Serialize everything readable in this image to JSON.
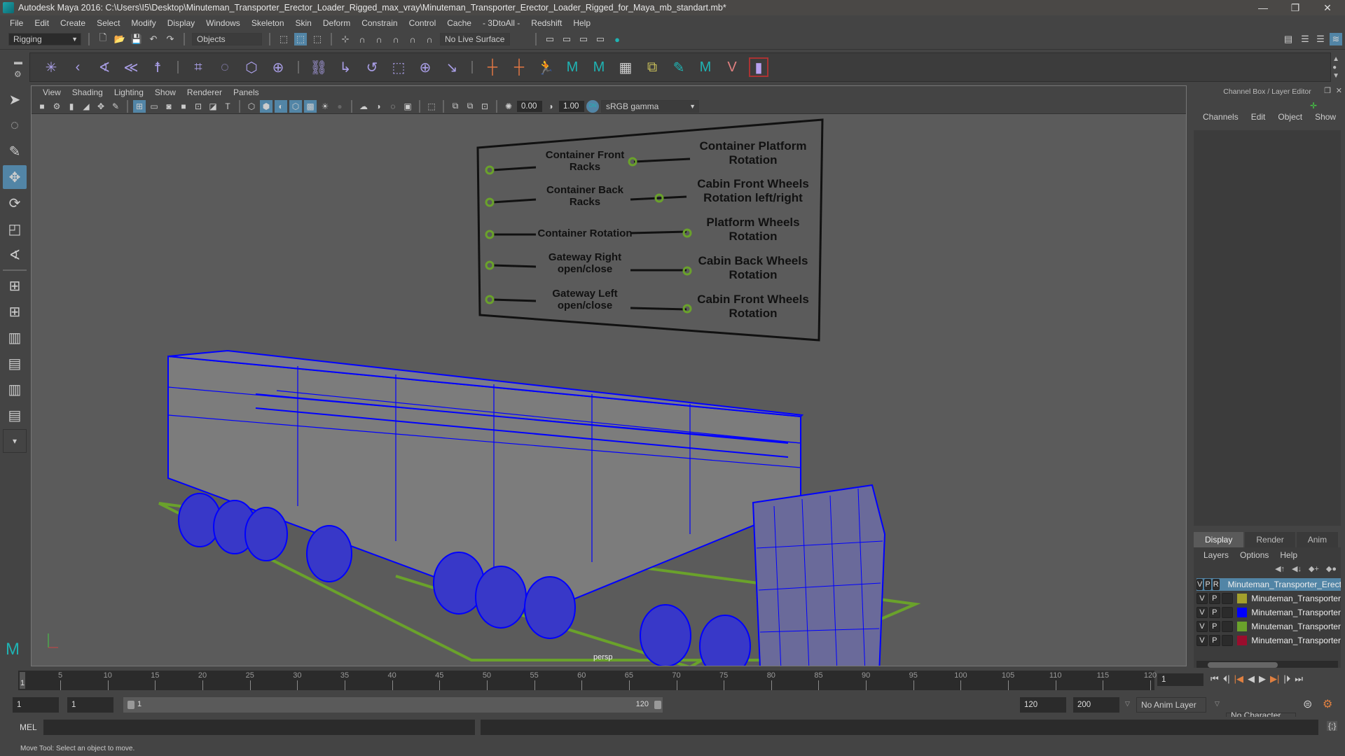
{
  "window": {
    "title": "Autodesk Maya 2016: C:\\Users\\I5\\Desktop\\Minuteman_Transporter_Erector_Loader_Rigged_max_vray\\Minuteman_Transporter_Erector_Loader_Rigged_for_Maya_mb_standart.mb*",
    "controls": [
      "minimize",
      "restore",
      "close"
    ]
  },
  "menubar": [
    "File",
    "Edit",
    "Create",
    "Select",
    "Modify",
    "Display",
    "Windows",
    "Skeleton",
    "Skin",
    "Deform",
    "Constrain",
    "Control",
    "Cache",
    "- 3DtoAll -",
    "Redshift",
    "Help"
  ],
  "statusline": {
    "menuset": "Rigging",
    "selection_mode": "Objects",
    "live_surface": "No Live Surface"
  },
  "viewport": {
    "panel_menu": [
      "View",
      "Shading",
      "Lighting",
      "Show",
      "Renderer",
      "Panels"
    ],
    "exposure": "0.00",
    "gamma": "1.00",
    "color_mgmt": "ON",
    "colorspace": "sRGB gamma",
    "camera": "persp",
    "control_board": {
      "left": [
        "Container Front Racks",
        "Container Back Racks",
        "Container Rotation",
        "Gateway Right open/close",
        "Gateway Left open/close"
      ],
      "right": [
        "Container Platform Rotation",
        "Cabin Front Wheels Rotation left/right",
        "Platform Wheels Rotation",
        "Cabin Back Wheels Rotation",
        "Cabin Front Wheels Rotation"
      ]
    },
    "colors": {
      "wireframe": "#0000ff",
      "ground": "#6aa22b",
      "background": "#5b5b5b"
    }
  },
  "channel_box": {
    "title": "Channel Box / Layer Editor",
    "menu": [
      "Channels",
      "Edit",
      "Object",
      "Show"
    ]
  },
  "layer_editor": {
    "tabs": [
      "Display",
      "Render",
      "Anim"
    ],
    "active_tab": "Display",
    "menu": [
      "Layers",
      "Options",
      "Help"
    ],
    "layers": [
      {
        "v": "V",
        "p": "P",
        "r": "R",
        "color": "#0e4d24",
        "name": "Minuteman_Transporter_Erector",
        "selected": true
      },
      {
        "v": "V",
        "p": "P",
        "r": "",
        "color": "#a3a02c",
        "name": "Minuteman_Transporter",
        "selected": false
      },
      {
        "v": "V",
        "p": "P",
        "r": "",
        "color": "#0000ff",
        "name": "Minuteman_Transporter",
        "selected": false
      },
      {
        "v": "V",
        "p": "P",
        "r": "",
        "color": "#6aa22b",
        "name": "Minuteman_Transporter",
        "selected": false
      },
      {
        "v": "V",
        "p": "P",
        "r": "",
        "color": "#9a0d2d",
        "name": "Minuteman_Transporter",
        "selected": false
      }
    ]
  },
  "timeline": {
    "ticks": [
      5,
      10,
      15,
      20,
      25,
      30,
      35,
      40,
      45,
      50,
      55,
      60,
      65,
      70,
      75,
      80,
      85,
      90,
      95,
      100,
      105,
      110,
      115,
      120
    ],
    "range_start": 1,
    "range_end": 120,
    "current_frame": "1",
    "current_marker": "1"
  },
  "range": {
    "start": "1",
    "playback_start": "1",
    "slider_start_label": "1",
    "slider_end_label": "120",
    "playback_end": "120",
    "end": "200",
    "anim_layer": "No Anim Layer",
    "character_set": "No Character Set"
  },
  "cmdline": {
    "label": "MEL"
  },
  "helpline": {
    "text": "Move Tool: Select an object to move."
  }
}
